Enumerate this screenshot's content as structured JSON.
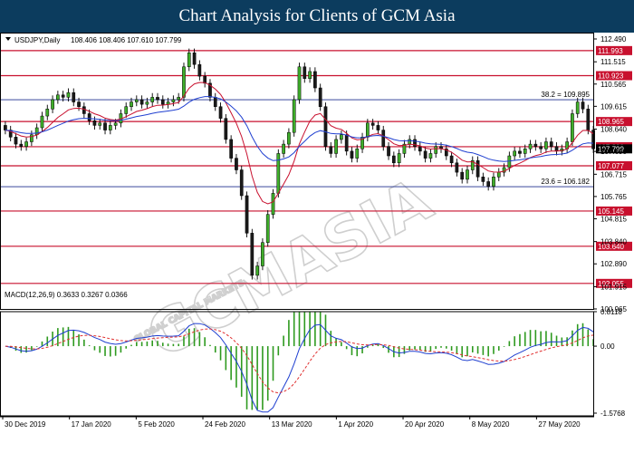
{
  "banner": {
    "title": "Chart Analysis for Clients of GCM Asia"
  },
  "header": {
    "symbol": "USDJPY,Daily",
    "ohlc": "108.406 108.406 107.610 107.799"
  },
  "macd_header": "MACD(12,26,9) 0.3633 0.3267 0.0366",
  "watermark": {
    "main": "GCMASIA",
    "sub": "GLOBAL CAPITAL MARKETS"
  },
  "colors": {
    "level_line": "#c8102e",
    "fib_line": "#1f2f8f",
    "ma_fast": "#c8102e",
    "ma_slow": "#1f3fd0",
    "histogram": "#2e9a1f",
    "macd_line": "#1f3fd0",
    "signal_line": "#e03030"
  },
  "chart_data": [
    {
      "type": "candlestick",
      "title": "USDJPY,Daily",
      "ylim": [
        100.965,
        112.49
      ],
      "y_ticks": [
        "112.490",
        "111.515",
        "110.565",
        "109.615",
        "108.640",
        "107.690",
        "106.715",
        "105.765",
        "104.815",
        "103.840",
        "102.890",
        "101.915",
        "100.965"
      ],
      "x_ticks": [
        "30 Dec 2019",
        "17 Jan 2020",
        "5 Feb 2020",
        "24 Feb 2020",
        "13 Mar 2020",
        "1 Apr 2020",
        "20 Apr 2020",
        "8 May 2020",
        "27 May 2020"
      ],
      "levels": [
        {
          "label": "111.993",
          "value": 111.993
        },
        {
          "label": "110.923",
          "value": 110.923
        },
        {
          "label": "108.965",
          "value": 108.965
        },
        {
          "label": "107.890",
          "value": 107.89
        },
        {
          "label": "107.077",
          "value": 107.077
        },
        {
          "label": "105.145",
          "value": 105.145
        },
        {
          "label": "103.640",
          "value": 103.64
        },
        {
          "label": "102.055",
          "value": 102.055
        }
      ],
      "fib_levels": [
        {
          "label": "38.2 = 109.895",
          "value": 109.895
        },
        {
          "label": "23.6 = 106.182",
          "value": 106.182
        }
      ],
      "current_price": 107.799,
      "closes": [
        108.6,
        108.3,
        108.0,
        107.9,
        108.1,
        108.4,
        108.7,
        109.2,
        109.5,
        109.9,
        110.1,
        110.0,
        110.2,
        109.8,
        109.6,
        109.3,
        109.0,
        108.8,
        108.9,
        108.6,
        108.8,
        108.9,
        109.3,
        109.6,
        109.8,
        109.9,
        109.7,
        109.8,
        110.0,
        109.9,
        109.7,
        109.8,
        109.9,
        110.0,
        111.3,
        111.9,
        111.4,
        110.9,
        110.6,
        110.0,
        109.6,
        109.1,
        108.2,
        107.4,
        106.9,
        105.8,
        104.2,
        102.4,
        102.8,
        103.8,
        105.0,
        105.9,
        107.6,
        108.0,
        108.5,
        109.9,
        111.3,
        110.8,
        111.1,
        110.4,
        109.6,
        107.9,
        107.6,
        108.2,
        108.4,
        107.7,
        107.4,
        107.8,
        108.3,
        108.9,
        108.8,
        108.6,
        107.9,
        107.5,
        107.2,
        107.6,
        108.0,
        108.2,
        107.9,
        107.7,
        107.4,
        107.6,
        107.9,
        107.8,
        107.5,
        107.2,
        106.8,
        106.5,
        106.9,
        107.3,
        106.6,
        106.4,
        106.2,
        106.6,
        106.8,
        107.0,
        107.5,
        107.7,
        107.6,
        107.8,
        108.0,
        107.9,
        107.8,
        108.1,
        107.9,
        107.7,
        107.8,
        108.1,
        109.3,
        109.8,
        109.5,
        108.6,
        107.8
      ]
    },
    {
      "type": "macd",
      "title": "MACD(12,26,9) 0.3633 0.3267 0.0366",
      "ylim": [
        -1.5768,
        0.8118
      ],
      "y_ticks": [
        "0.8118",
        "0.00",
        "-1.5768"
      ]
    }
  ]
}
